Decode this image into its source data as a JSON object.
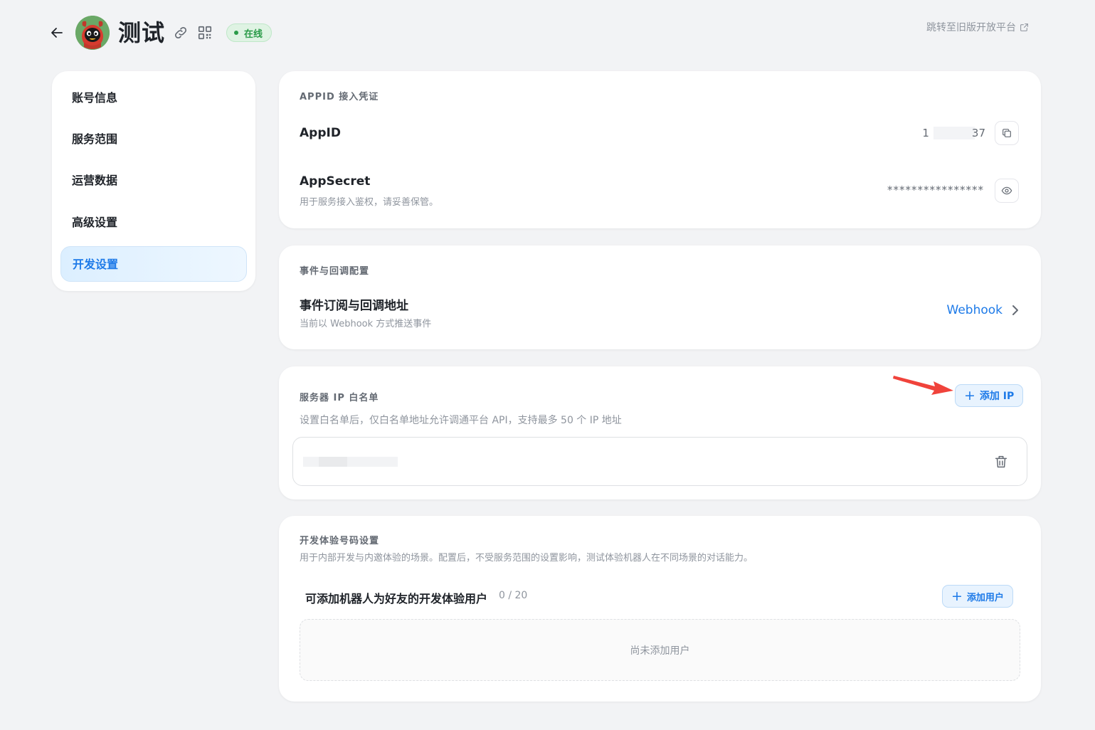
{
  "header": {
    "title": "测试",
    "status": "在线",
    "old_platform_link": "跳转至旧版开放平台"
  },
  "sidebar": {
    "items": [
      {
        "label": "账号信息"
      },
      {
        "label": "服务范围"
      },
      {
        "label": "运营数据"
      },
      {
        "label": "高级设置"
      },
      {
        "label": "开发设置"
      }
    ],
    "active_index": 4
  },
  "credentials": {
    "section_title": "APPID 接入凭证",
    "appid_label": "AppID",
    "appid_prefix": "1",
    "appid_suffix": "37",
    "appsecret_label": "AppSecret",
    "appsecret_desc": "用于服务接入鉴权，请妥善保管。",
    "appsecret_masked": "****************"
  },
  "events": {
    "section_title": "事件与回调配置",
    "row_title": "事件订阅与回调地址",
    "row_desc": "当前以 Webhook 方式推送事件",
    "mode": "Webhook"
  },
  "ip_whitelist": {
    "section_title": "服务器 IP 白名单",
    "add_label": "添加 IP",
    "description": "设置白名单后，仅白名单地址允许调通平台 API，支持最多 50 个 IP 地址"
  },
  "dev_users": {
    "section_title": "开发体验号码设置",
    "description": "用于内部开发与内邀体验的场景。配置后，不受服务范围的设置影响，测试体验机器人在不同场景的对话能力。",
    "list_title": "可添加机器人为好友的开发体验用户",
    "count": "0 / 20",
    "add_label": "添加用户",
    "empty_text": "尚未添加用户"
  },
  "colors": {
    "accent": "#1d7ae8",
    "status_green": "#2a9b48",
    "annotation_arrow": "#f0433b",
    "page_bg": "#f2f3f5"
  },
  "icons": [
    "back-arrow-icon",
    "avatar",
    "link-icon",
    "qr-code-icon",
    "external-link-icon",
    "copy-icon",
    "eye-icon",
    "chevron-right-icon",
    "plus-icon",
    "trash-icon",
    "annotation-arrow"
  ]
}
